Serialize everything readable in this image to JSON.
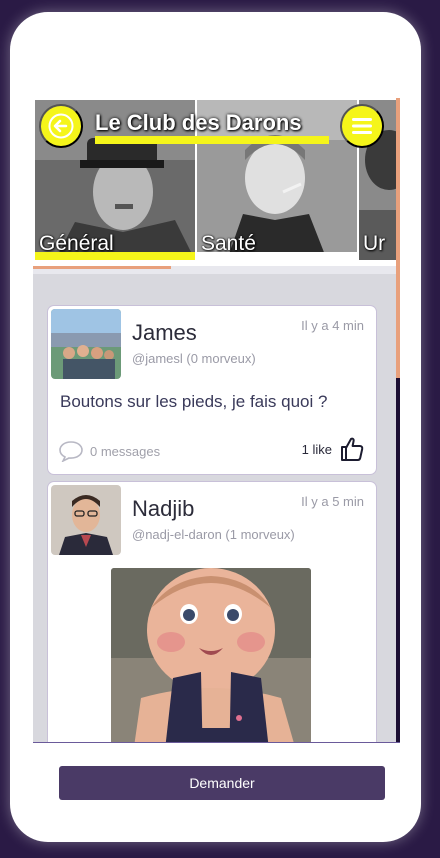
{
  "header": {
    "title": "Le Club des Darons",
    "back_icon": "arrow-left-icon",
    "menu_icon": "hamburger-icon"
  },
  "colors": {
    "accent_yellow": "#f5f51a",
    "accent_orange": "#e8a07c",
    "dark_bg": "#1c0f33",
    "button_bg": "#4a3a66"
  },
  "categories": [
    {
      "label": "Général",
      "active": true
    },
    {
      "label": "Santé",
      "active": false
    },
    {
      "label": "Ur",
      "active": false
    }
  ],
  "posts": [
    {
      "name": "James",
      "handle": "@jamesl (0 morveux)",
      "time": "Il y a 4 min",
      "text": "Boutons sur les pieds, je fais quoi ?",
      "comments": "0 messages",
      "likes": "1 like"
    },
    {
      "name": "Nadjib",
      "handle": "@nadj-el-daron (1 morveux)",
      "time": "Il y a 5 min"
    }
  ],
  "footer": {
    "ask_label": "Demander"
  }
}
